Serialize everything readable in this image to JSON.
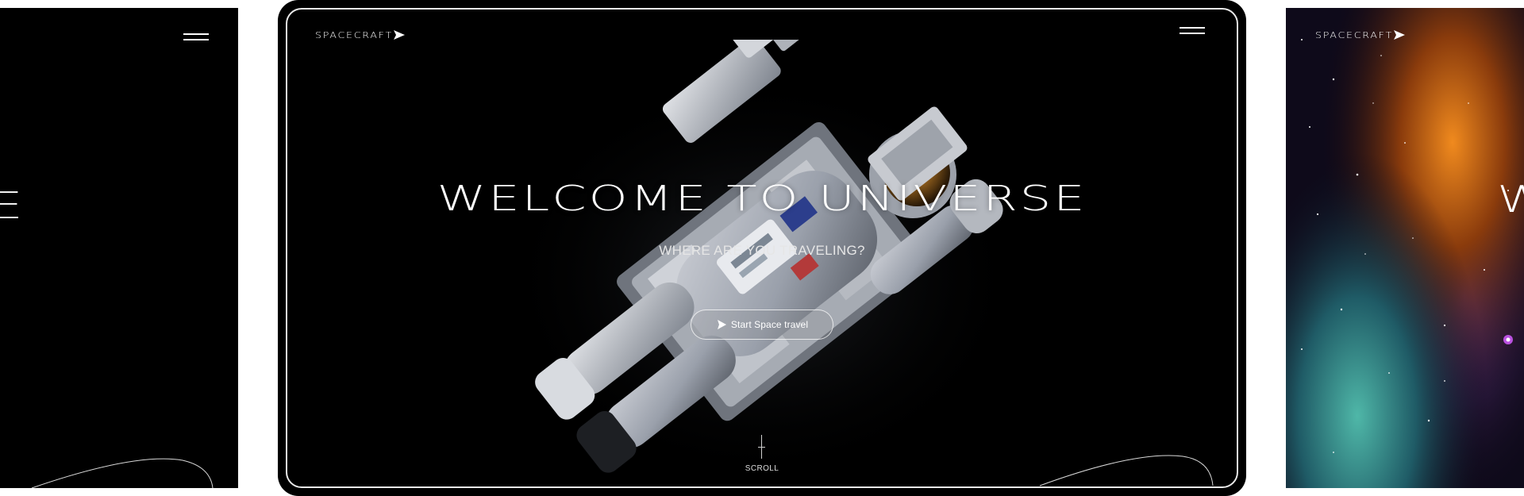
{
  "brand": {
    "name": "SPACECRAFT"
  },
  "hero": {
    "title": "WELCOME TO UNIVERSE",
    "subtitle": "WHERE ARE YOU TRAVELING?",
    "cta_label": "Start Space travel"
  },
  "scroll": {
    "label": "SCROLL"
  },
  "left_preview": {
    "headline_fragment": "E"
  },
  "right_preview": {
    "headline_fragment": "W"
  },
  "colors": {
    "background": "#000000",
    "text": "#ffffff",
    "frame": "#e8e8e8",
    "page": "#ffffff"
  },
  "icons": [
    "menu-icon",
    "spacecraft-logo-icon",
    "play-icon",
    "orbit-arc",
    "astronaut-image",
    "nebula-image"
  ]
}
